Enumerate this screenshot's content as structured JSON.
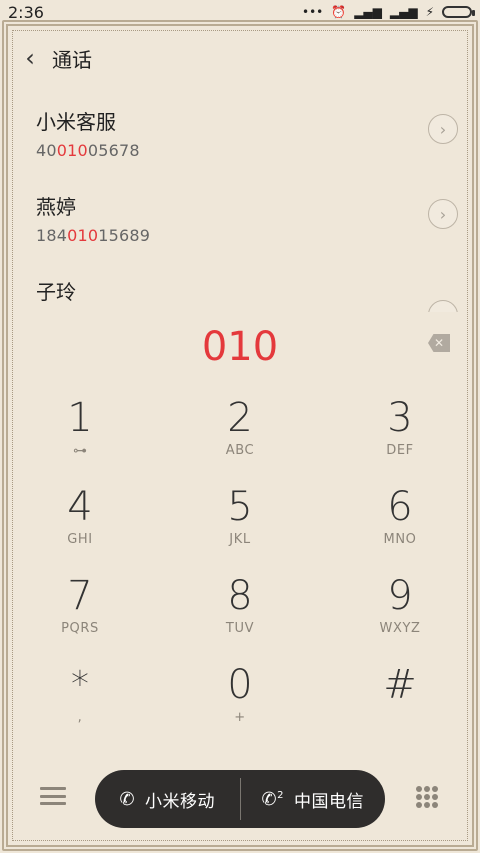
{
  "status": {
    "time": "2:36",
    "dots": "•••",
    "alarm_icon": "alarm-clock-icon",
    "signal1_icon": "signal-icon",
    "signal2_icon": "signal-icon",
    "charging_icon": "lightning-icon",
    "battery_color": "#39c039"
  },
  "header": {
    "back_glyph": "‹",
    "title": "通话"
  },
  "contacts": [
    {
      "name": "小米客服",
      "number_pre": "40",
      "number_hl": "010",
      "number_post": "05678"
    },
    {
      "name": "燕婷",
      "number_pre": "184",
      "number_hl": "010",
      "number_post": "15689"
    },
    {
      "name": "子玲",
      "number_pre": "",
      "number_hl": "",
      "number_post": ""
    }
  ],
  "dialed": "010",
  "dialpad": [
    {
      "digit": "1",
      "letters": "",
      "icon": "voicemail-icon"
    },
    {
      "digit": "2",
      "letters": "ABC"
    },
    {
      "digit": "3",
      "letters": "DEF"
    },
    {
      "digit": "4",
      "letters": "GHI"
    },
    {
      "digit": "5",
      "letters": "JKL"
    },
    {
      "digit": "6",
      "letters": "MNO"
    },
    {
      "digit": "7",
      "letters": "PQRS"
    },
    {
      "digit": "8",
      "letters": "TUV"
    },
    {
      "digit": "9",
      "letters": "WXYZ"
    },
    {
      "digit": "*",
      "letters": ","
    },
    {
      "digit": "0",
      "letters": "+"
    },
    {
      "digit": "#",
      "letters": ""
    }
  ],
  "sim": {
    "sim1_label": "小米移动",
    "sim2_label": "中国电信",
    "sim2_badge": "2"
  },
  "colors": {
    "accent_red": "#e4393c",
    "pill_bg": "#2f2d2c"
  }
}
